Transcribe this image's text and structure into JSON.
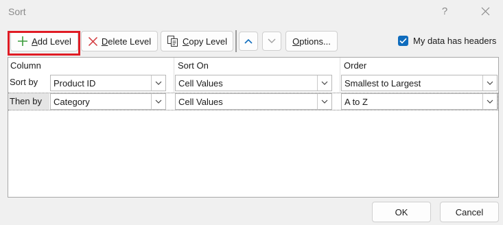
{
  "window": {
    "title": "Sort",
    "help_glyph": "?"
  },
  "toolbar": {
    "add_level": "Add Level",
    "delete_level": "Delete Level",
    "copy_level": "Copy Level",
    "options": "Options...",
    "headers_checkbox_label": "My data has headers",
    "headers_checked": true,
    "icons": [
      "plus-icon",
      "delete-x-icon",
      "copy-icon",
      "chevron-up-icon",
      "chevron-down-icon"
    ]
  },
  "grid": {
    "headers": {
      "column": "Column",
      "sort_on": "Sort On",
      "order": "Order"
    },
    "rows": [
      {
        "label": "Sort by",
        "column": "Product ID",
        "sort_on": "Cell Values",
        "order": "Smallest to Largest"
      },
      {
        "label": "Then by",
        "column": "Category",
        "sort_on": "Cell Values",
        "order": "A to Z"
      }
    ]
  },
  "footer": {
    "ok": "OK",
    "cancel": "Cancel"
  },
  "colors": {
    "accent": "#0f6cbd",
    "highlight": "#e01b24",
    "plus": "#3a9b3a",
    "delete": "#d13438"
  }
}
